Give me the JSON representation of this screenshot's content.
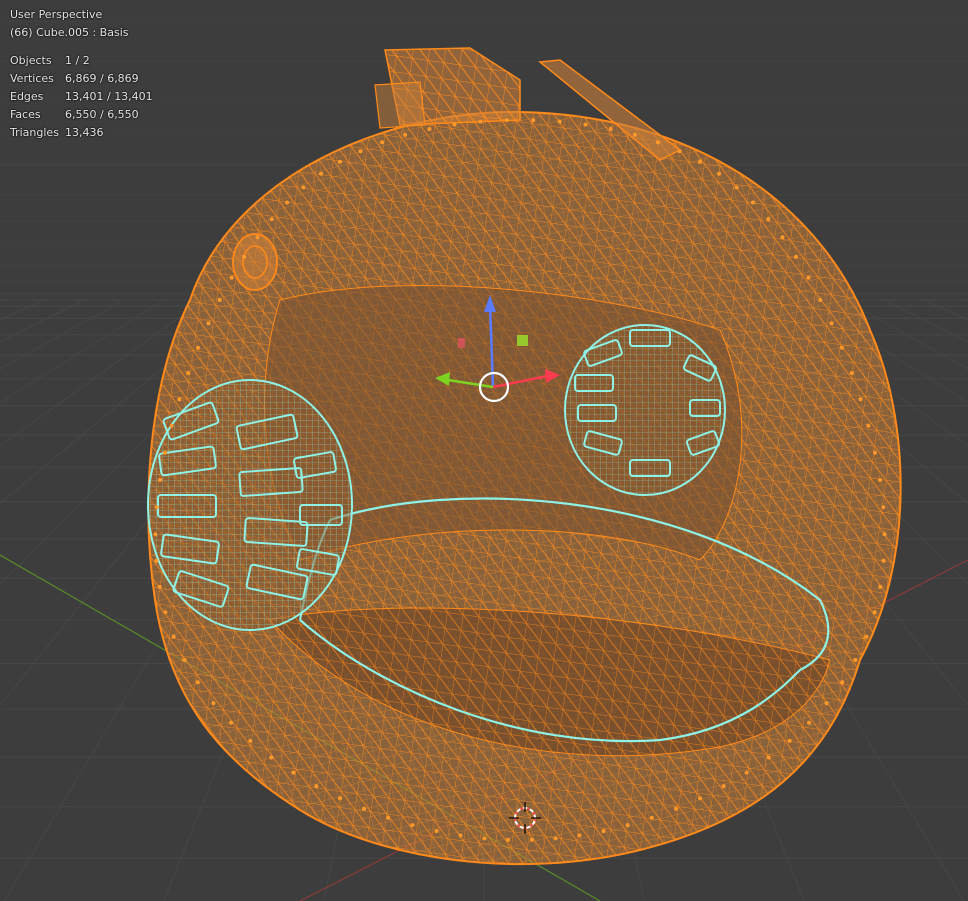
{
  "viewport": {
    "view_name": "User Perspective",
    "object_info": "(66) Cube.005 : Basis"
  },
  "stats": [
    {
      "label": "Objects",
      "value": "1 / 2"
    },
    {
      "label": "Vertices",
      "value": "6,869 / 6,869"
    },
    {
      "label": "Edges",
      "value": "13,401 / 13,401"
    },
    {
      "label": "Faces",
      "value": "6,550 / 6,550"
    },
    {
      "label": "Triangles",
      "value": "13,436"
    }
  ],
  "colors": {
    "background": "#3d3d3d",
    "grid_line": "#464646",
    "x_axis": "#8a3a3a",
    "y_axis": "#5a8a2a",
    "wireframe": "#ff8a1a",
    "fill": "#c97f3a",
    "selected_edges": "#8ef2e6",
    "gizmo_z": "#5a7bff",
    "gizmo_x": "#ff3b4f",
    "gizmo_y": "#7ed321"
  },
  "icons": {
    "gizmo": "transform-gizmo-icon",
    "cursor": "3d-cursor-icon"
  }
}
